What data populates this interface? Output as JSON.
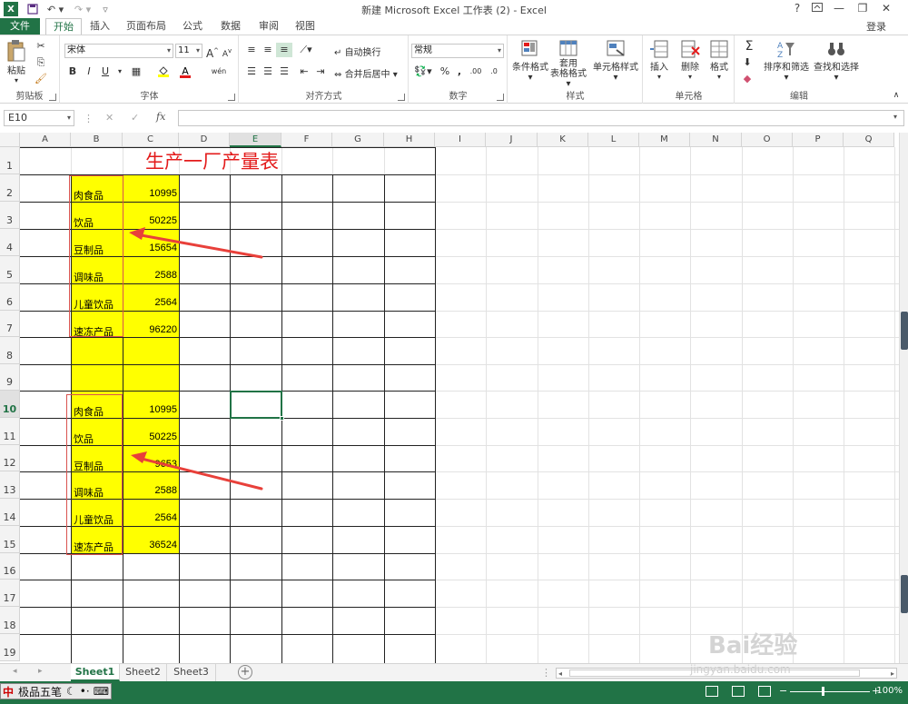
{
  "window": {
    "title": "新建 Microsoft Excel 工作表 (2) - Excel",
    "help": "?",
    "login": "登录"
  },
  "tabs": [
    "开始",
    "插入",
    "页面布局",
    "公式",
    "数据",
    "审阅",
    "视图"
  ],
  "file_tab": "文件",
  "active_tab": "开始",
  "ribbon": {
    "clipboard": {
      "label": "剪贴板",
      "paste": "粘贴"
    },
    "font": {
      "label": "字体",
      "name": "宋体",
      "size": "11",
      "bold": "B",
      "italic": "I",
      "underline": "U",
      "grow": "A",
      "shrink": "A",
      "phonetic": "wén"
    },
    "align": {
      "label": "对齐方式",
      "wrap": "自动换行",
      "merge": "合并后居中"
    },
    "number": {
      "label": "数字",
      "format": "常规",
      "percent": "%",
      "comma": ",",
      "inc": ".00",
      "dec": ".0"
    },
    "styles": {
      "label": "样式",
      "cond": "条件格式",
      "table_line1": "套用",
      "table_line2": "表格格式",
      "cellstyle": "单元格样式"
    },
    "cells": {
      "label": "单元格",
      "insert": "插入",
      "delete": "删除",
      "format": "格式"
    },
    "editing": {
      "label": "编辑",
      "sort": "排序和筛选",
      "find": "查找和选择",
      "sum": "Σ"
    }
  },
  "formula_bar": {
    "name_box": "E10",
    "fx": "fx",
    "cancel": "✕",
    "enter": "✓",
    "content": ""
  },
  "columns": [
    "A",
    "B",
    "C",
    "D",
    "E",
    "F",
    "G",
    "H",
    "I",
    "J",
    "K",
    "L",
    "M",
    "N",
    "O",
    "P",
    "Q"
  ],
  "active_column": "E",
  "active_row": "10",
  "rows": [
    "1",
    "2",
    "3",
    "4",
    "5",
    "6",
    "7",
    "8",
    "9",
    "10",
    "11",
    "12",
    "13",
    "14",
    "15",
    "16",
    "17",
    "18",
    "19"
  ],
  "sheet": {
    "title": "生产一厂产量表",
    "block1": [
      {
        "name": "肉食品",
        "value": "10995"
      },
      {
        "name": "饮品",
        "value": "50225"
      },
      {
        "name": "豆制品",
        "value": "15654"
      },
      {
        "name": "调味品",
        "value": "2588"
      },
      {
        "name": "儿童饮品",
        "value": "2564"
      },
      {
        "name": "速冻产品",
        "value": "96220"
      }
    ],
    "block2": [
      {
        "name": "肉食品",
        "value": "10995"
      },
      {
        "name": "饮品",
        "value": "50225"
      },
      {
        "name": "豆制品",
        "value": "9653"
      },
      {
        "name": "调味品",
        "value": "2588"
      },
      {
        "name": "儿童饮品",
        "value": "2564"
      },
      {
        "name": "速冻产品",
        "value": "36524"
      }
    ]
  },
  "sheet_tabs": [
    "Sheet1",
    "Sheet2",
    "Sheet3"
  ],
  "active_sheet": "Sheet1",
  "status": {
    "ime": "极品五笔",
    "ime_cn": "中",
    "zoom": "100%"
  },
  "watermark": {
    "brand": "Bai经验",
    "url": "jingyan.baidu.com"
  },
  "colors": {
    "excel_green": "#217346",
    "highlight": "#ffff00",
    "title_red": "#e31b1b",
    "arrow_red": "#e8403a"
  }
}
